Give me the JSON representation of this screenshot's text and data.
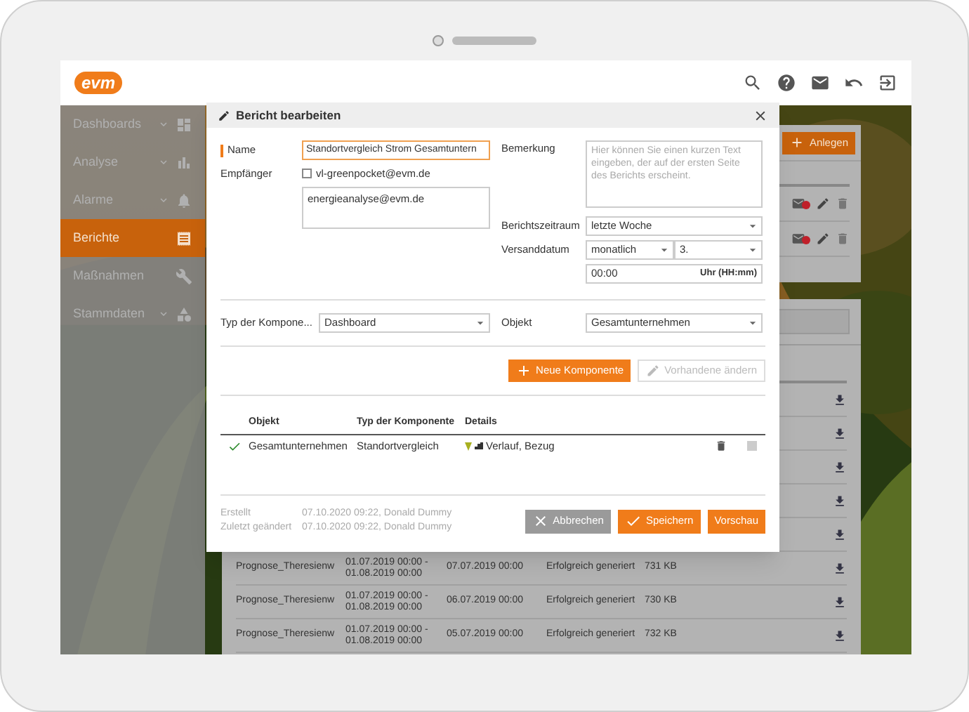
{
  "header": {
    "logo": "evm"
  },
  "sidebar": {
    "items": [
      {
        "label": "Dashboards",
        "has_submenu": true,
        "selected": false
      },
      {
        "label": "Analyse",
        "has_submenu": true,
        "selected": false
      },
      {
        "label": "Alarme",
        "has_submenu": true,
        "selected": false
      },
      {
        "label": "Berichte",
        "has_submenu": false,
        "selected": true
      },
      {
        "label": "Maßnahmen",
        "has_submenu": false,
        "selected": false
      },
      {
        "label": "Stammdaten",
        "has_submenu": true,
        "selected": false
      }
    ]
  },
  "schedules": {
    "create_button": "Anlegen",
    "rows": [
      {
        "kind": "covered"
      },
      {
        "kind": "covered"
      }
    ]
  },
  "reports": {
    "rows": [
      {
        "kind": "covered"
      },
      {
        "kind": "covered"
      },
      {
        "kind": "covered"
      },
      {
        "kind": "covered"
      },
      {
        "kind": "covered"
      },
      {
        "kind": "full",
        "name": "Prognose_Theresienw",
        "period_start": "01.07.2019 00:00 -",
        "period_end": "01.08.2019 00:00",
        "created": "07.07.2019 00:00",
        "status": "Erfolgreich generiert",
        "size": "731 KB"
      },
      {
        "kind": "full",
        "name": "Prognose_Theresienw",
        "period_start": "01.07.2019 00:00 -",
        "period_end": "01.08.2019 00:00",
        "created": "06.07.2019 00:00",
        "status": "Erfolgreich generiert",
        "size": "730 KB"
      },
      {
        "kind": "full",
        "name": "Prognose_Theresienw",
        "period_start": "01.07.2019 00:00 -",
        "period_end": "01.08.2019 00:00",
        "created": "05.07.2019 00:00",
        "status": "Erfolgreich generiert",
        "size": "732 KB"
      }
    ]
  },
  "modal": {
    "title": "Bericht bearbeiten",
    "name": {
      "label": "Name",
      "value": "Standortvergleich Strom Gesamtuntern",
      "focused": true
    },
    "recipients": {
      "label": "Empfänger",
      "option": {
        "label": "vl-greenpocket@evm.de",
        "checked": false
      },
      "value": "energieanalyse@evm.de"
    },
    "remark": {
      "label": "Bemerkung",
      "placeholder": "Hier können Sie einen kurzen Text eingeben, der auf der ersten Seite des Berichts erscheint."
    },
    "period": {
      "label": "Berichtszeitraum",
      "value": "letzte Woche"
    },
    "send_date": {
      "label": "Versanddatum",
      "frequency": "monatlich",
      "day": "3.",
      "time": "00:00",
      "time_suffix": "Uhr (HH:mm)"
    },
    "component_type": {
      "label": "Typ der Kompone...",
      "value": "Dashboard"
    },
    "object": {
      "label": "Objekt",
      "value": "Gesamtunternehmen"
    },
    "component_buttons": [
      {
        "label": "Neue Komponente",
        "disabled": false
      },
      {
        "label": "Vorhandene ändern",
        "disabled": true
      }
    ],
    "components": {
      "columns": [
        "Objekt",
        "Typ der Komponente",
        "Details"
      ],
      "rows": [
        {
          "valid": true,
          "object": "Gesamtunternehmen",
          "type": "Standortvergleich",
          "details": "Verlauf, Bezug"
        }
      ]
    },
    "meta": [
      {
        "label": "Erstellt",
        "value": "07.10.2020 09:22, Donald Dummy"
      },
      {
        "label": "Zuletzt geändert",
        "value": "07.10.2020 09:22, Donald Dummy"
      }
    ],
    "actions": [
      {
        "label": "Abbrechen",
        "kind": "cancel"
      },
      {
        "label": "Speichern",
        "kind": "save"
      },
      {
        "label": "Vorschau",
        "kind": "preview"
      }
    ]
  }
}
